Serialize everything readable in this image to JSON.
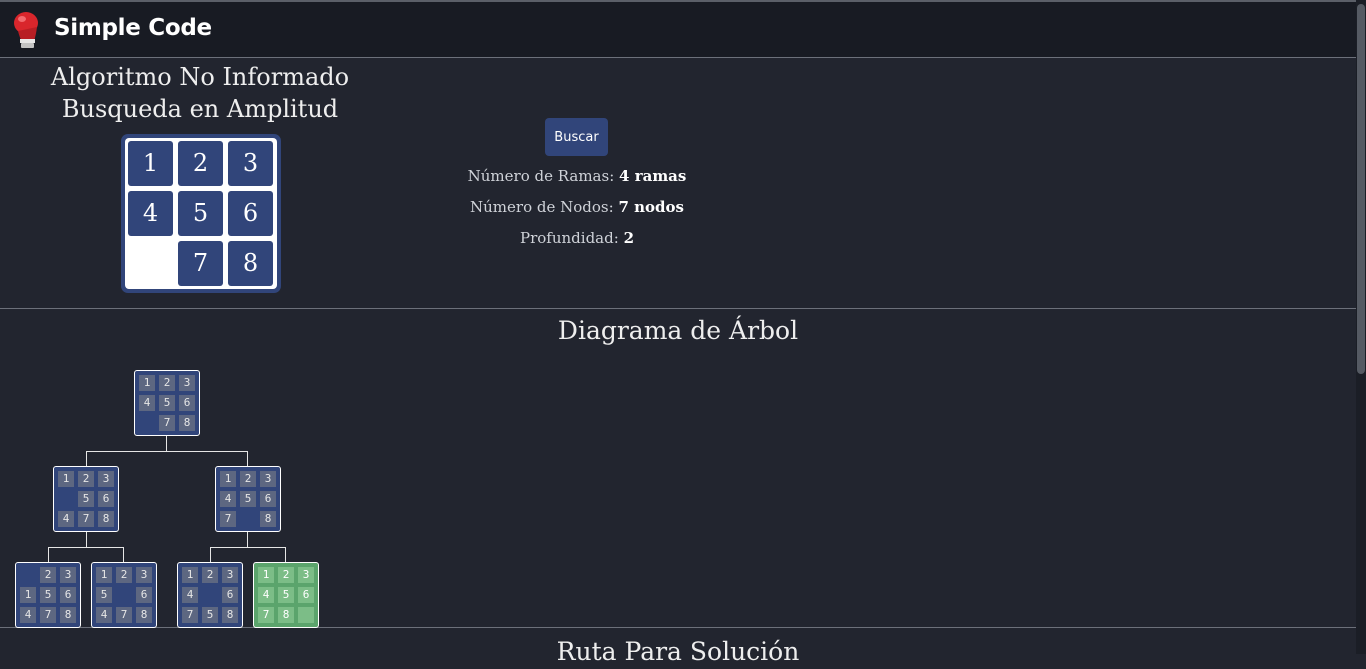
{
  "header": {
    "brand": "Simple Code",
    "logo_icon": "boxing-glove-icon"
  },
  "algorithm": {
    "title_line1": "Algoritmo No Informado",
    "title_line2": "Busqueda en Amplitud"
  },
  "puzzle": {
    "tiles": [
      "1",
      "2",
      "3",
      "4",
      "5",
      "6",
      "",
      "7",
      "8"
    ]
  },
  "search": {
    "button_label": "Buscar"
  },
  "stats": {
    "branches_label": "Número de Ramas:",
    "branches_value": "4 ramas",
    "nodes_label": "Número de Nodos:",
    "nodes_value": "7 nodos",
    "depth_label": "Profundidad:",
    "depth_value": "2"
  },
  "tree": {
    "title": "Diagrama de Árbol",
    "nodes": [
      {
        "tiles": [
          "1",
          "2",
          "3",
          "4",
          "5",
          "6",
          "",
          "7",
          "8"
        ],
        "goal": false
      },
      {
        "tiles": [
          "1",
          "2",
          "3",
          "",
          "5",
          "6",
          "4",
          "7",
          "8"
        ],
        "goal": false
      },
      {
        "tiles": [
          "1",
          "2",
          "3",
          "4",
          "5",
          "6",
          "7",
          "",
          "8"
        ],
        "goal": false
      },
      {
        "tiles": [
          "",
          "2",
          "3",
          "1",
          "5",
          "6",
          "4",
          "7",
          "8"
        ],
        "goal": false
      },
      {
        "tiles": [
          "1",
          "2",
          "3",
          "5",
          "",
          "6",
          "4",
          "7",
          "8"
        ],
        "goal": false
      },
      {
        "tiles": [
          "1",
          "2",
          "3",
          "4",
          "",
          "6",
          "7",
          "5",
          "8"
        ],
        "goal": false
      },
      {
        "tiles": [
          "1",
          "2",
          "3",
          "4",
          "5",
          "6",
          "7",
          "8",
          ""
        ],
        "goal": true
      }
    ],
    "goal_color": "#5ba46c",
    "node_color": "#31457a"
  },
  "route": {
    "title": "Ruta Para Solución"
  }
}
